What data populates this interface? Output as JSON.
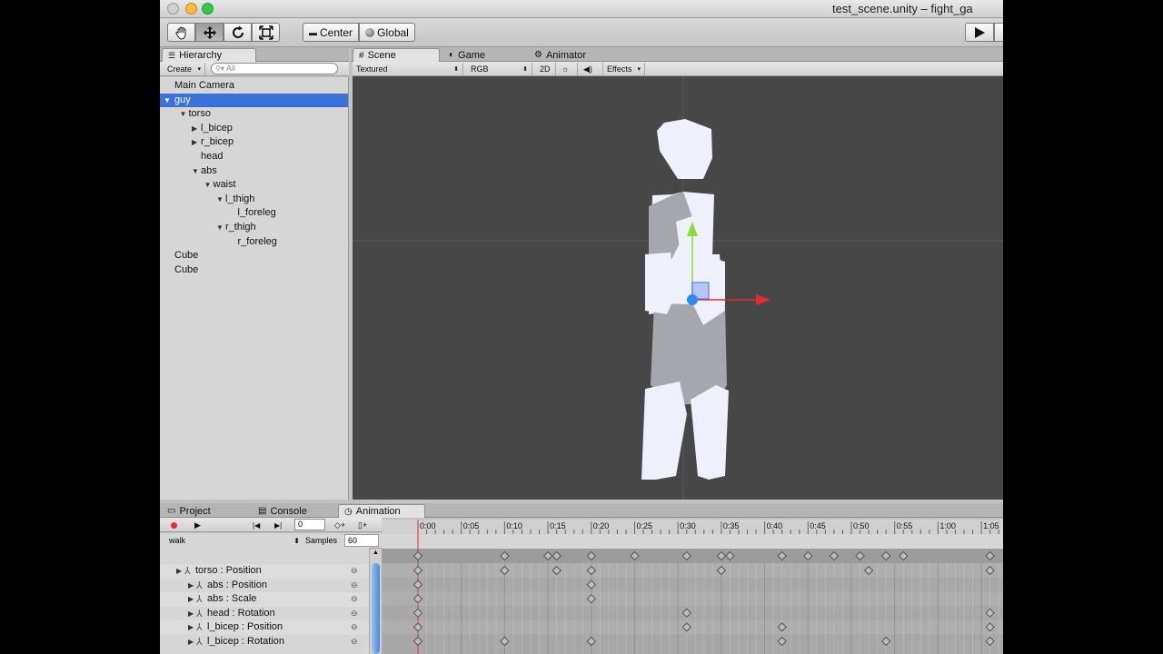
{
  "window": {
    "title": "test_scene.unity – fight_ga",
    "traffic_lights": {
      "close": "#fc605c",
      "minimize": "#fdbc40",
      "zoom": "#34c84a"
    }
  },
  "toolbar": {
    "tools": [
      "hand-icon",
      "move-icon",
      "rotate-icon",
      "scale-icon"
    ],
    "pivot_label": "Center",
    "space_label": "Global",
    "play_icon": "play-icon"
  },
  "hierarchy": {
    "tab_label": "Hierarchy",
    "create_label": "Create",
    "search_placeholder": "All",
    "items": [
      {
        "label": "Main Camera",
        "depth": 0,
        "arrow": "",
        "selected": false
      },
      {
        "label": "guy",
        "depth": 0,
        "arrow": "open",
        "selected": true
      },
      {
        "label": "torso",
        "depth": 1,
        "arrow": "open",
        "selected": false
      },
      {
        "label": "l_bicep",
        "depth": 2,
        "arrow": "closed",
        "selected": false
      },
      {
        "label": "r_bicep",
        "depth": 2,
        "arrow": "closed",
        "selected": false
      },
      {
        "label": "head",
        "depth": 2,
        "arrow": "",
        "selected": false
      },
      {
        "label": "abs",
        "depth": 2,
        "arrow": "open",
        "selected": false
      },
      {
        "label": "waist",
        "depth": 3,
        "arrow": "open",
        "selected": false
      },
      {
        "label": "l_thigh",
        "depth": 4,
        "arrow": "open",
        "selected": false
      },
      {
        "label": "l_foreleg",
        "depth": 5,
        "arrow": "",
        "selected": false
      },
      {
        "label": "r_thigh",
        "depth": 4,
        "arrow": "open",
        "selected": false
      },
      {
        "label": "r_foreleg",
        "depth": 5,
        "arrow": "",
        "selected": false
      },
      {
        "label": "Cube",
        "depth": 0,
        "arrow": "",
        "selected": false
      },
      {
        "label": "Cube",
        "depth": 0,
        "arrow": "",
        "selected": false
      }
    ]
  },
  "scene": {
    "tabs": [
      {
        "label": "Scene",
        "icon": "grid-icon",
        "selected": true
      },
      {
        "label": "Game",
        "icon": "pacman-icon",
        "selected": false
      },
      {
        "label": "Animator",
        "icon": "animator-icon",
        "selected": false
      }
    ],
    "shading_mode": "Textured",
    "render_mode": "RGB",
    "toggle_2d": "2D",
    "effects_label": "Effects",
    "background": "#474747",
    "figure_color": "#eef0fb",
    "shadow_color": "#a6a7ac",
    "gizmo_colors": {
      "x": "#e42a2a",
      "y": "#8dd93a",
      "z": "#2e8dee"
    }
  },
  "bottom": {
    "tabs": [
      {
        "label": "Project",
        "icon": "folder-icon",
        "selected": false
      },
      {
        "label": "Console",
        "icon": "console-icon",
        "selected": false
      },
      {
        "label": "Animation",
        "icon": "clock-icon",
        "selected": true
      }
    ]
  },
  "animation": {
    "frame_value": "0",
    "clip_name": "walk",
    "samples_label": "Samples",
    "samples_value": "60",
    "time_labels": [
      "0:00",
      "0:05",
      "0:10",
      "0:15",
      "0:20",
      "0:25",
      "0:30",
      "0:35",
      "0:40",
      "0:45",
      "0:50",
      "0:55",
      "1:00",
      "1:05"
    ],
    "tracks": [
      {
        "label": "torso : Position",
        "indent": 0,
        "keys": [
          0,
          10,
          16,
          20,
          35,
          52,
          66
        ]
      },
      {
        "label": "abs : Position",
        "indent": 1,
        "keys": [
          0,
          20
        ]
      },
      {
        "label": "abs : Scale",
        "indent": 1,
        "keys": [
          0,
          20
        ]
      },
      {
        "label": "head : Rotation",
        "indent": 1,
        "keys": [
          0,
          31,
          66
        ]
      },
      {
        "label": "l_bicep : Position",
        "indent": 1,
        "keys": [
          0,
          31,
          42,
          66
        ]
      },
      {
        "label": "l_bicep : Rotation",
        "indent": 1,
        "keys": [
          0,
          10,
          20,
          42,
          54,
          66
        ]
      }
    ],
    "summary_keys": [
      0,
      10,
      15,
      16,
      20,
      25,
      31,
      35,
      36,
      42,
      45,
      48,
      51,
      54,
      56,
      66
    ]
  }
}
